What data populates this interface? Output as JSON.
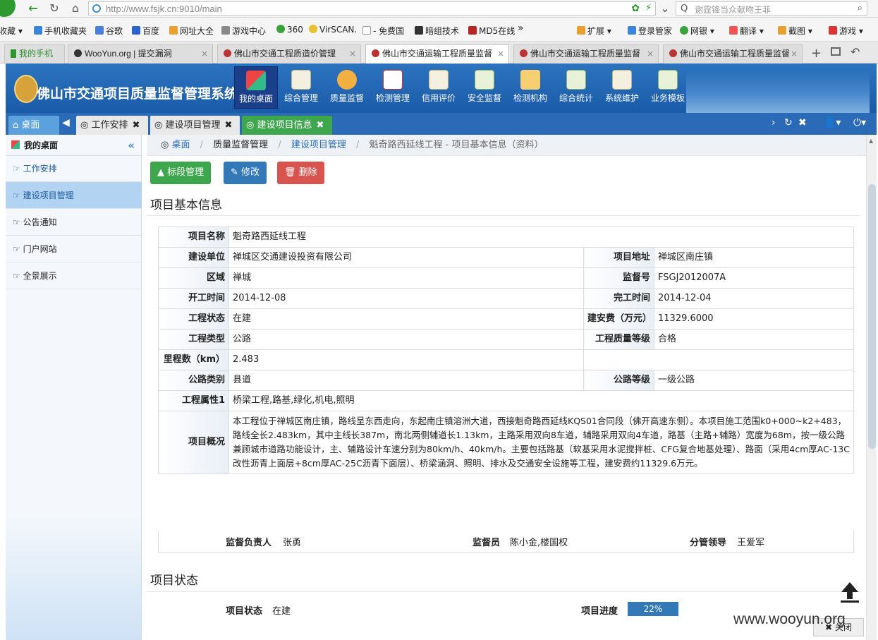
{
  "browser": {
    "url": "http://www.fsjk.cn:9010/main",
    "search_placeholder": "谢霆锋当众献吻王菲",
    "bookmarks": [
      "收藏",
      "手机收藏夹",
      "谷歌",
      "百度",
      "网址大全",
      "游戏中心",
      "360",
      "VirSCAN.",
      "- 免费国",
      "暗组技术",
      "MD5在线"
    ],
    "bookmarks_more": "»",
    "toolbar_right": [
      "扩展",
      "登录管家",
      "网银",
      "翻译",
      "截图",
      "游戏"
    ],
    "tabs": [
      {
        "label": "我的手机"
      },
      {
        "label": "WooYun.org | 提交漏洞"
      },
      {
        "label": "佛山市交通工程质造价管理"
      },
      {
        "label": "佛山市交通运输工程质量监督"
      },
      {
        "label": "佛山市交通运输工程质量监督"
      },
      {
        "label": "佛山市交通运输工程质量监督"
      }
    ],
    "new_tab": "+"
  },
  "app": {
    "title": "佛山市交通项目质量监督管理系统Ⅱ",
    "menu": [
      "我的桌面",
      "综合管理",
      "质量监督",
      "检测管理",
      "信用评价",
      "安全监督",
      "检测机构",
      "综合统计",
      "系统维护",
      "业务模板"
    ]
  },
  "tabbar": {
    "home": "桌面",
    "tabs": [
      "工作安排",
      "建设项目管理",
      "建设项目信息"
    ]
  },
  "sidebar": {
    "header": "我的桌面",
    "items": [
      "工作安排",
      "建设项目管理",
      "公告通知",
      "门户网站",
      "全景展示"
    ]
  },
  "breadcrumb": {
    "home": "桌面",
    "level1": "质量监督管理",
    "level2": "建设项目管理",
    "current": "魁奇路西延线工程 - 项目基本信息（资料）"
  },
  "actions": {
    "section": "标段管理",
    "edit": "修改",
    "delete": "删除"
  },
  "basic_info": {
    "title": "项目基本信息",
    "rows": {
      "project_name": {
        "label": "项目名称",
        "value": "魁奇路西延线工程"
      },
      "builder": {
        "label": "建设单位",
        "value": "禅城区交通建设投资有限公司"
      },
      "address": {
        "label": "项目地址",
        "value": "禅城区南庄镇"
      },
      "region": {
        "label": "区域",
        "value": "禅城"
      },
      "supervise_no": {
        "label": "监督号",
        "value": "FSGJ2012007A"
      },
      "start_date": {
        "label": "开工时间",
        "value": "2014-12-08"
      },
      "end_date": {
        "label": "完工时间",
        "value": "2014-12-04"
      },
      "status": {
        "label": "工程状态",
        "value": "在建"
      },
      "cost": {
        "label": "建安费（万元）",
        "value": "11329.6000"
      },
      "type": {
        "label": "工程类型",
        "value": "公路"
      },
      "quality": {
        "label": "工程质量等级",
        "value": "合格"
      },
      "mileage": {
        "label": "里程数（km）",
        "value": "2.483"
      },
      "road_category": {
        "label": "公路类别",
        "value": "县道"
      },
      "road_grade": {
        "label": "公路等级",
        "value": "一级公路"
      },
      "attributes": {
        "label": "工程属性1",
        "value": "桥梁工程,路基,绿化,机电,照明"
      },
      "overview": {
        "label": "项目概况",
        "value": "本工程位于禅城区南庄镇，路线呈东西走向，东起南庄镇溶洲大道，西接魁奇路西延线KQS01合同段（佛开高速东侧）。本项目施工范围k0+000~k2+483，路线全长2.483km，其中主线长387m，南北两侧辅道长1.13km，主路采用双向8车道，辅路采用双向4车道，路基（主路+辅路）宽度为68m，按一级公路兼顾城市道路功能设计，主、辅路设计车速分别为80km/h、40km/h。主要包括路基（软基采用水泥搅拌桩、CFG复合地基处理）、路面（采用4cm厚AC-13C改性沥青上面层+8cm厚AC-25C沥青下面层）、桥梁涵洞、照明、排水及交通安全设施等工程，建安费约11329.6万元。"
      }
    },
    "supervisor_label": "监督负责人",
    "supervisor": "张勇",
    "inspector_label": "监督员",
    "inspector": "陈小金,楼国权",
    "leader_label": "分管领导",
    "leader": "王爱军"
  },
  "project_status": {
    "title": "项目状态",
    "status_label": "项目状态",
    "status": "在建",
    "progress_label": "项目进度",
    "progress_text": "22%",
    "progress": 0.22
  },
  "watermark": "www.wooyun.org",
  "close_label": "关闭",
  "colors": {
    "header_blue": "#1a5ba8",
    "tab_green": "#3ea64c",
    "btn_green": "#3ea64c",
    "btn_blue": "#3378b7",
    "btn_red": "#d9534f",
    "sidebar_active": "#b3d3f2"
  }
}
